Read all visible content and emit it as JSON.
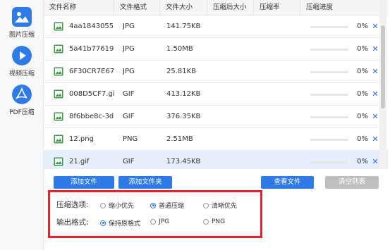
{
  "sidebar": {
    "items": [
      {
        "label": "图片压缩",
        "icon": "image-icon"
      },
      {
        "label": "视频压缩",
        "icon": "play-icon"
      },
      {
        "label": "PDF压缩",
        "icon": "pdf-icon"
      }
    ]
  },
  "table": {
    "headers": [
      "文件名称",
      "文件格式",
      "文件大小",
      "压缩后大小",
      "压缩率",
      "压缩进度"
    ],
    "rows": [
      {
        "name": "4aa18430557...",
        "format": "JPG",
        "size": "141.75KB",
        "progress": "0%",
        "progress_value": 0
      },
      {
        "name": "5a41b776197...",
        "format": "JPG",
        "size": "1.50MB",
        "progress": "0%",
        "progress_value": 0
      },
      {
        "name": "6F30CR7E672...",
        "format": "JPG",
        "size": "25.81KB",
        "progress": "0%",
        "progress_value": 0
      },
      {
        "name": "008D5CF7.gif",
        "format": "GIF",
        "size": "413.12KB",
        "progress": "0%",
        "progress_value": 0
      },
      {
        "name": "8f6bbe8c-3d...",
        "format": "GIF",
        "size": "376.35KB",
        "progress": "0%",
        "progress_value": 0
      },
      {
        "name": "12.png",
        "format": "PNG",
        "size": "2.51MB",
        "progress": "0%",
        "progress_value": 0
      },
      {
        "name": "21.gif",
        "format": "GIF",
        "size": "173.45KB",
        "progress": "0%",
        "progress_value": 0
      }
    ],
    "remove_glyph": "✕"
  },
  "buttons": {
    "add_file": "添加文件",
    "add_folder": "添加文件夹",
    "view_files": "查看文件",
    "clear_list": "清空列表"
  },
  "options": {
    "compress_label": "压缩选项:",
    "compress_choices": [
      {
        "label": "缩小优先",
        "checked": false
      },
      {
        "label": "普通压缩",
        "checked": true
      },
      {
        "label": "清晰优先",
        "checked": false
      }
    ],
    "output_label": "输出格式:",
    "output_choices": [
      {
        "label": "保持原格式",
        "checked": true
      },
      {
        "label": "JPG",
        "checked": false
      },
      {
        "label": "PNG",
        "checked": false
      }
    ]
  },
  "colors": {
    "accent": "#2e7ae6",
    "highlight_border": "#e0242f",
    "selected_row": "#e6f0fc",
    "file_icon": "#3d9a4a"
  }
}
